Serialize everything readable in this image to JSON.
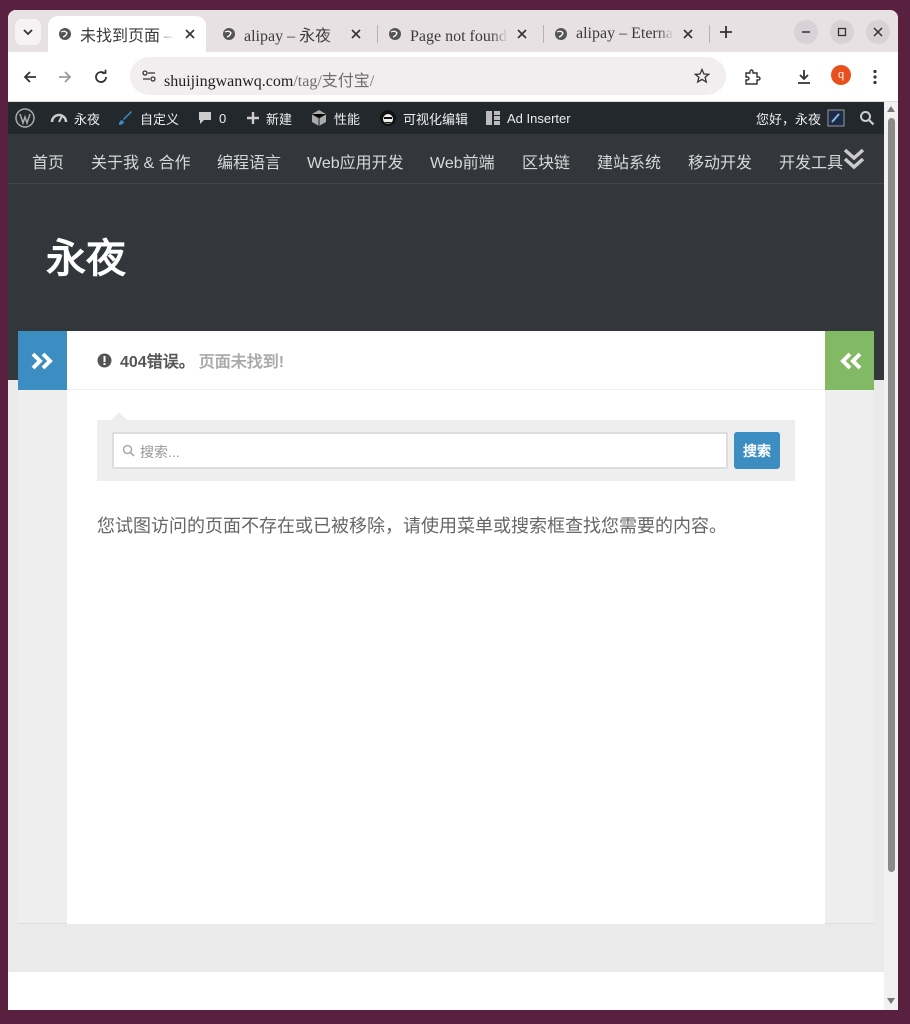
{
  "browser": {
    "tabs": [
      {
        "title": "未找到页面 – 永夜",
        "active": true
      },
      {
        "title": "alipay – 永夜",
        "active": false
      },
      {
        "title": "Page not found – 永夜",
        "active": false
      },
      {
        "title": "alipay – Eternal Night",
        "active": false
      }
    ],
    "url_domain": "shuijingwanwq.com",
    "url_path": "/tag/支付宝/",
    "profile_initial": "q"
  },
  "adminbar": {
    "site_name": "永夜",
    "customize": "自定义",
    "comments_count": "0",
    "new": "新建",
    "performance": "性能",
    "visual_editor": "可视化编辑",
    "ad_inserter": "Ad Inserter",
    "greeting": "您好，永夜"
  },
  "nav": {
    "items": [
      "首页",
      "关于我 & 合作",
      "编程语言",
      "Web应用开发",
      "Web前端",
      "区块链",
      "建站系统",
      "移动开发",
      "开发工具"
    ]
  },
  "site": {
    "title": "永夜"
  },
  "page": {
    "error_code": "404错误。",
    "error_text": "页面未找到!",
    "search_placeholder": "搜索...",
    "search_button": "搜索",
    "message": "您试图访问的页面不存在或已被移除，请使用菜单或搜索框查找您需要的内容。"
  },
  "colors": {
    "accent_blue": "#3b8dc2",
    "accent_green": "#82b965",
    "header_dark": "#33363b",
    "adminbar": "#23282d"
  }
}
